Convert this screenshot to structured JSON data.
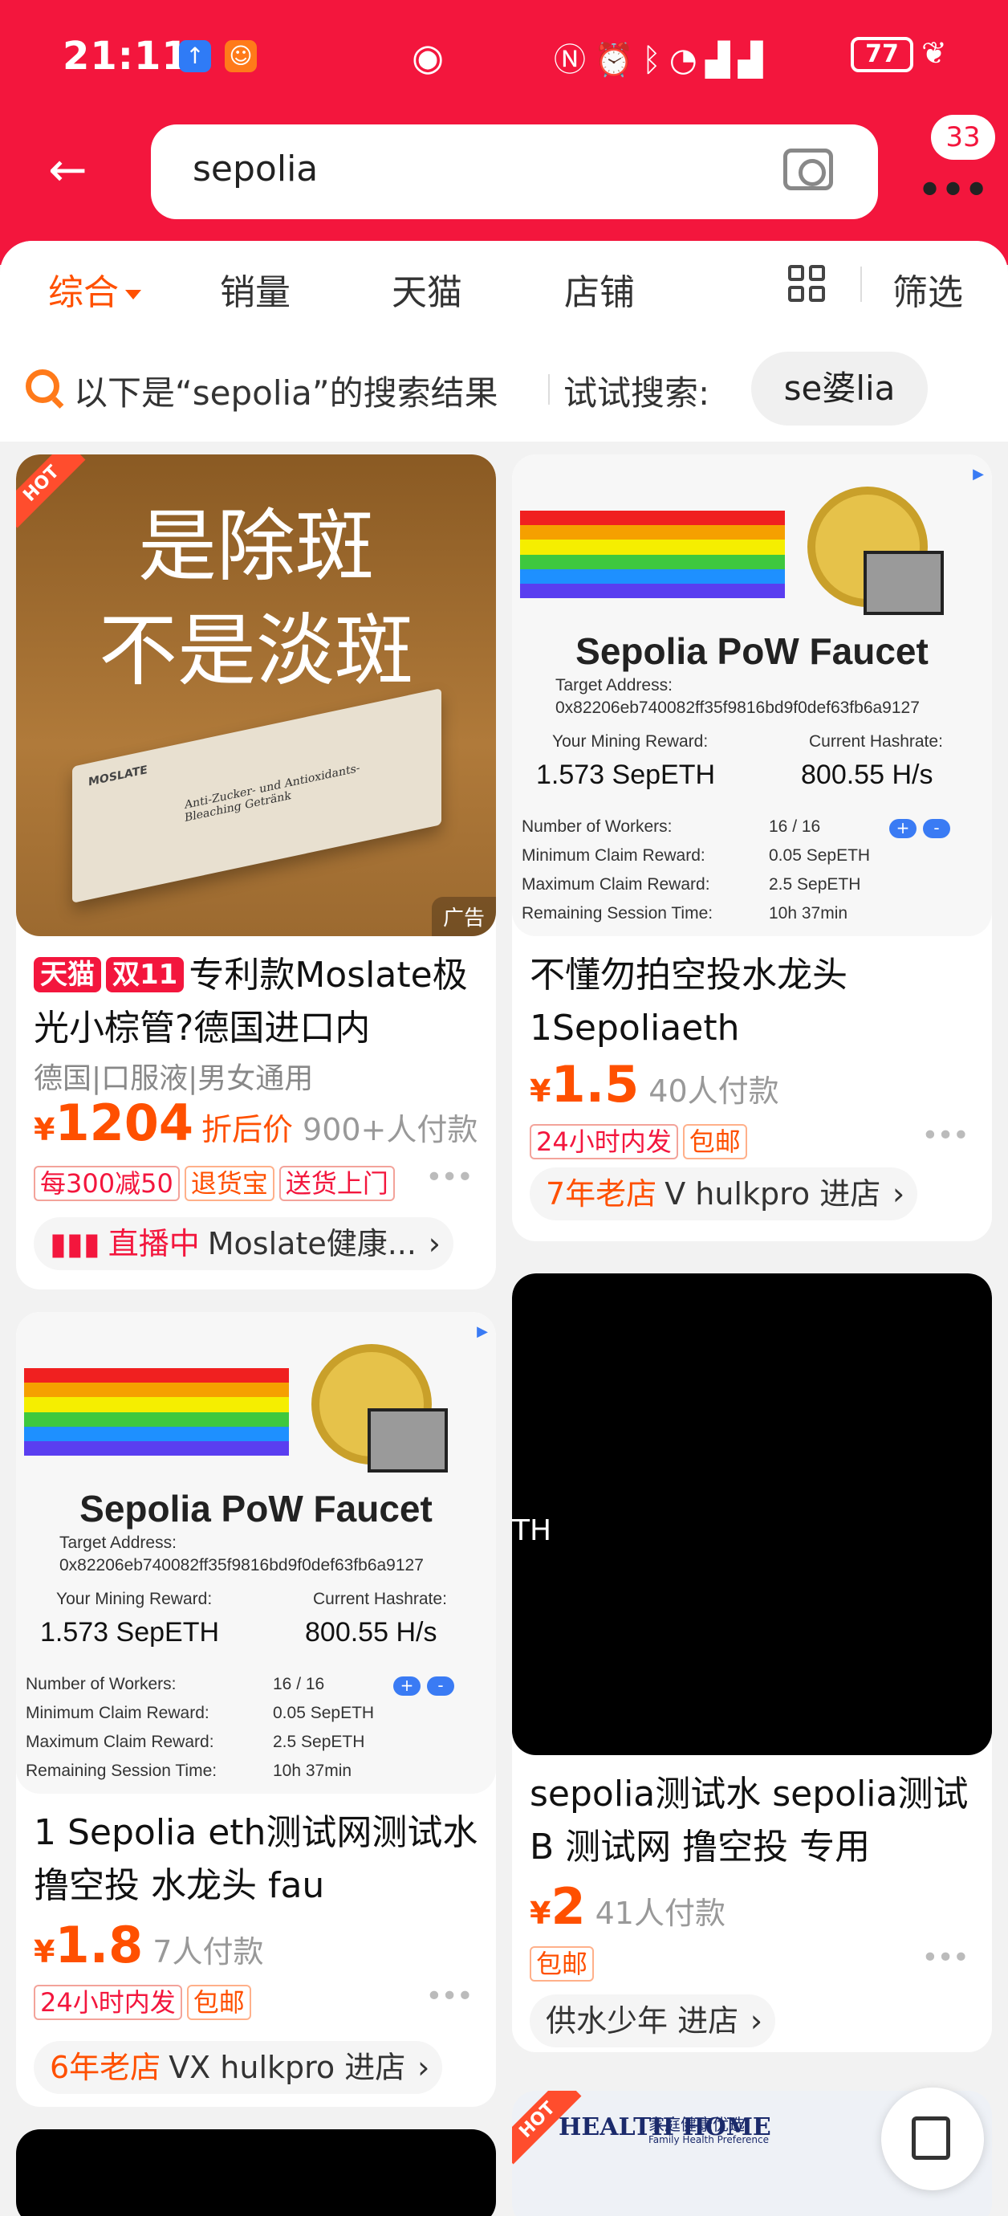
{
  "status_bar": {
    "time": "21:11",
    "battery": "77",
    "icons": [
      "upload-app-icon",
      "app-icon",
      "eye-icon",
      "nfc-icon",
      "alarm-icon",
      "bluetooth-icon",
      "wifi-icon",
      "signal-icon",
      "signal-icon",
      "battery-icon",
      "leaf-icon"
    ]
  },
  "nav": {
    "search_query": "sepolia",
    "message_count": "33"
  },
  "tabs": [
    {
      "label": "综合",
      "active": true
    },
    {
      "label": "销量"
    },
    {
      "label": "天猫"
    },
    {
      "label": "店铺"
    }
  ],
  "filter_label": "筛选",
  "hint": {
    "text": "以下是“sepolia”的搜索结果",
    "try_label": "试试搜索:",
    "suggestion": "se婆lia"
  },
  "products": [
    {
      "image_text_line1": "是除斑",
      "image_text_line2": "不是淡斑",
      "box_brand": "MOSLATE",
      "box_text": "Anti-Zucker- und Antioxidants-Bleaching Getränk",
      "hot": "HOT",
      "ad": "广告",
      "tag1": "天猫",
      "tag2": "双11",
      "title": "专利款Moslate极光小棕管?德国进口内",
      "specs": "德国|口服液|男女通用",
      "currency": "¥",
      "price": "1204",
      "price_label": "折后价",
      "sold": "900+人付款",
      "badges": [
        "每300减50",
        "退货宝",
        "送货上门"
      ],
      "live": "直播中",
      "shop": "Moslate健康...",
      "dots": "•••"
    },
    {
      "faucet_title": "Sepolia PoW Faucet",
      "target_label": "Target Address:",
      "address": "0x82206eb740082ff35f9816bd9f0def63fb6a9127",
      "reward_label": "Your Mining Reward:",
      "reward": "1.573 SepETH",
      "hashrate_label": "Current Hashrate:",
      "hashrate": "800.55 H/s",
      "workers_label": "Number of Workers:",
      "workers": "16 / 16",
      "min_label": "Minimum Claim Reward:",
      "min": "0.05 SepETH",
      "max_label": "Maximum Claim Reward:",
      "max": "2.5 SepETH",
      "remain_label": "Remaining Session Time:",
      "remain": "10h 37min",
      "title": "不懂勿拍空投水龙头1Sepoliaeth",
      "currency": "¥",
      "price": "1.5",
      "sold": "40人付款",
      "badges": [
        "24小时内发",
        "包邮"
      ],
      "shop_age": "7年老店",
      "shop": "V hulkpro 进店",
      "dots": "•••"
    },
    {
      "title": "1 Sepolia eth测试网测试水 撸空投 水龙头 fau",
      "currency": "¥",
      "price": "1.8",
      "sold": "7人付款",
      "badges": [
        "24小时内发",
        "包邮"
      ],
      "shop_age": "6年老店",
      "shop": "VX hulkpro 进店",
      "dots": "•••"
    },
    {
      "image_text": "TH",
      "title": "sepolia测试水 sepolia测试B 测试网 撸空投 专用",
      "currency": "¥",
      "price": "2",
      "sold": "41人付款",
      "badges": [
        "包邮"
      ],
      "shop": "供水少年 进店",
      "dots": "•••"
    },
    {
      "hot": "HOT",
      "brand": "HEALTH HOME",
      "brand_cn": "家庭健康优选",
      "brand_en": "Family Health Preference"
    }
  ]
}
